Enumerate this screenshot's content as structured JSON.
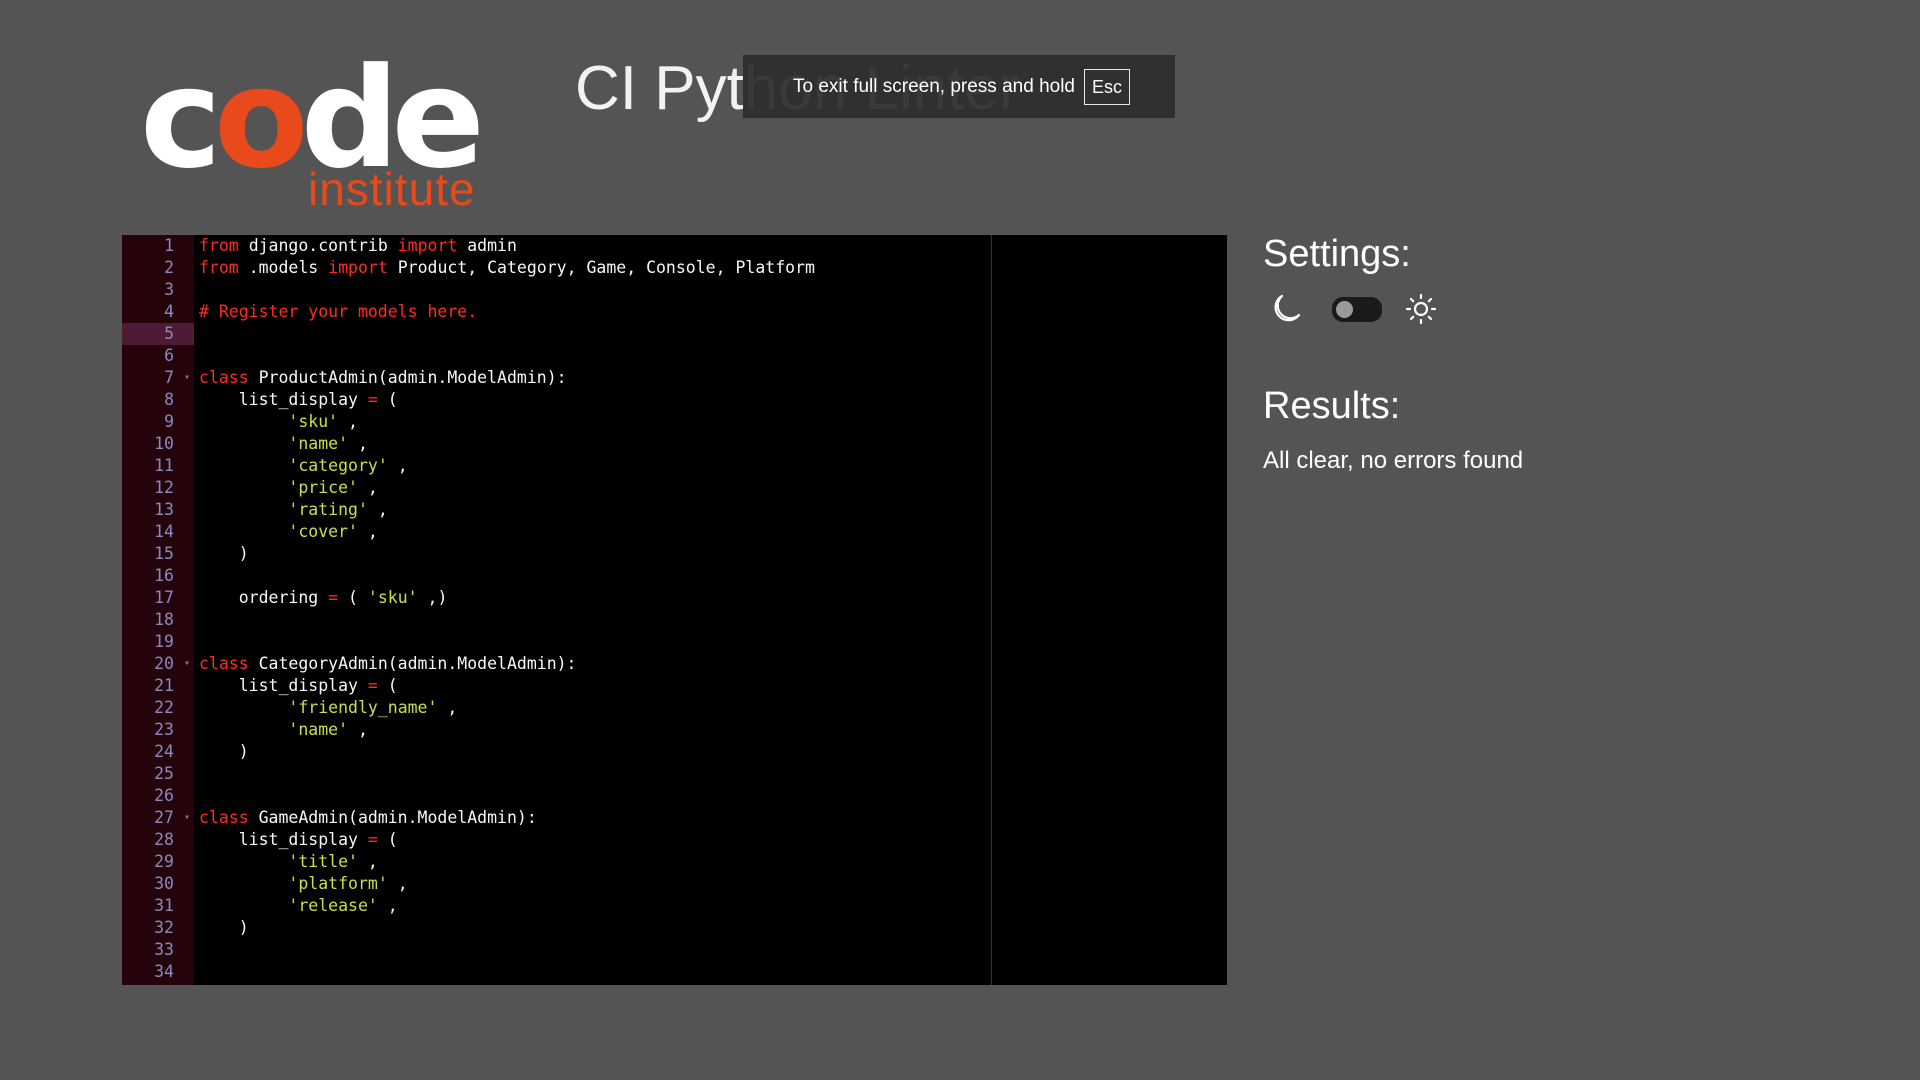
{
  "logo": {
    "word_part1": "c",
    "word_part2": "o",
    "word_part3": "de",
    "sub": "institute",
    "colors": {
      "white": "#ffffff",
      "orange": "#e84a1b"
    }
  },
  "app": {
    "title": "CI Python Linter"
  },
  "fullscreen_toast": {
    "text": "To exit full screen, press and hold",
    "key": "Esc"
  },
  "editor": {
    "active_line": 5,
    "lines": [
      {
        "n": "1",
        "t": [
          [
            "kw",
            "from"
          ],
          [
            "",
            "django.contrib"
          ],
          [
            "kw",
            "import"
          ],
          [
            "",
            "admin"
          ]
        ]
      },
      {
        "n": "2",
        "t": [
          [
            "kw",
            "from"
          ],
          [
            "",
            ".models"
          ],
          [
            "kw",
            "import"
          ],
          [
            "",
            "Product, Category, Game, Console, Platform"
          ]
        ]
      },
      {
        "n": "3",
        "t": []
      },
      {
        "n": "4",
        "t": [
          [
            "cm",
            "# Register your models here."
          ]
        ]
      },
      {
        "n": "5",
        "t": []
      },
      {
        "n": "6",
        "t": []
      },
      {
        "n": "7",
        "fold": true,
        "t": [
          [
            "kw",
            "class"
          ],
          [
            "",
            "ProductAdmin(admin.ModelAdmin):"
          ]
        ]
      },
      {
        "n": "8",
        "t": [
          [
            "",
            "    list_display"
          ],
          [
            "op",
            "="
          ],
          [
            "",
            "("
          ]
        ]
      },
      {
        "n": "9",
        "t": [
          [
            "",
            "        "
          ],
          [
            "str",
            "'sku'"
          ],
          [
            "",
            ","
          ]
        ]
      },
      {
        "n": "10",
        "t": [
          [
            "",
            "        "
          ],
          [
            "str",
            "'name'"
          ],
          [
            "",
            ","
          ]
        ]
      },
      {
        "n": "11",
        "t": [
          [
            "",
            "        "
          ],
          [
            "str",
            "'category'"
          ],
          [
            "",
            ","
          ]
        ]
      },
      {
        "n": "12",
        "t": [
          [
            "",
            "        "
          ],
          [
            "str",
            "'price'"
          ],
          [
            "",
            ","
          ]
        ]
      },
      {
        "n": "13",
        "t": [
          [
            "",
            "        "
          ],
          [
            "str",
            "'rating'"
          ],
          [
            "",
            ","
          ]
        ]
      },
      {
        "n": "14",
        "t": [
          [
            "",
            "        "
          ],
          [
            "str",
            "'cover'"
          ],
          [
            "",
            ","
          ]
        ]
      },
      {
        "n": "15",
        "t": [
          [
            "",
            "    )"
          ]
        ]
      },
      {
        "n": "16",
        "t": []
      },
      {
        "n": "17",
        "t": [
          [
            "",
            "    ordering"
          ],
          [
            "op",
            "="
          ],
          [
            "",
            "("
          ],
          [
            "str",
            "'sku'"
          ],
          [
            "",
            ",)"
          ]
        ]
      },
      {
        "n": "18",
        "t": []
      },
      {
        "n": "19",
        "t": []
      },
      {
        "n": "20",
        "fold": true,
        "t": [
          [
            "kw",
            "class"
          ],
          [
            "",
            "CategoryAdmin(admin.ModelAdmin):"
          ]
        ]
      },
      {
        "n": "21",
        "t": [
          [
            "",
            "    list_display"
          ],
          [
            "op",
            "="
          ],
          [
            "",
            "("
          ]
        ]
      },
      {
        "n": "22",
        "t": [
          [
            "",
            "        "
          ],
          [
            "str",
            "'friendly_name'"
          ],
          [
            "",
            ","
          ]
        ]
      },
      {
        "n": "23",
        "t": [
          [
            "",
            "        "
          ],
          [
            "str",
            "'name'"
          ],
          [
            "",
            ","
          ]
        ]
      },
      {
        "n": "24",
        "t": [
          [
            "",
            "    )"
          ]
        ]
      },
      {
        "n": "25",
        "t": []
      },
      {
        "n": "26",
        "t": []
      },
      {
        "n": "27",
        "fold": true,
        "t": [
          [
            "kw",
            "class"
          ],
          [
            "",
            "GameAdmin(admin.ModelAdmin):"
          ]
        ]
      },
      {
        "n": "28",
        "t": [
          [
            "",
            "    list_display"
          ],
          [
            "op",
            "="
          ],
          [
            "",
            "("
          ]
        ]
      },
      {
        "n": "29",
        "t": [
          [
            "",
            "        "
          ],
          [
            "str",
            "'title'"
          ],
          [
            "",
            ","
          ]
        ]
      },
      {
        "n": "30",
        "t": [
          [
            "",
            "        "
          ],
          [
            "str",
            "'platform'"
          ],
          [
            "",
            ","
          ]
        ]
      },
      {
        "n": "31",
        "t": [
          [
            "",
            "        "
          ],
          [
            "str",
            "'release'"
          ],
          [
            "",
            ","
          ]
        ]
      },
      {
        "n": "32",
        "t": [
          [
            "",
            "    )"
          ]
        ]
      },
      {
        "n": "33",
        "t": []
      },
      {
        "n": "34",
        "t": []
      }
    ]
  },
  "settings": {
    "title": "Settings:",
    "dark_mode_on": false
  },
  "results": {
    "title": "Results:",
    "text": "All clear, no errors found"
  }
}
